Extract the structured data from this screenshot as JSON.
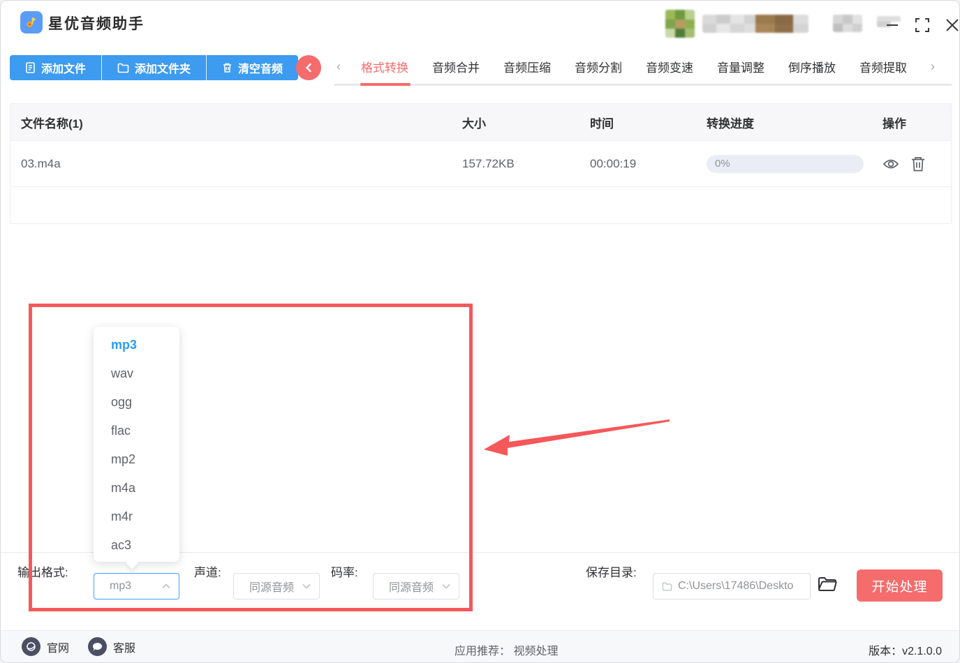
{
  "window": {
    "title": "星优音频助手"
  },
  "toolbar": {
    "add_file": "添加文件",
    "add_folder": "添加文件夹",
    "clear_audio": "清空音频"
  },
  "tabs": [
    "格式转换",
    "音频合并",
    "音频压缩",
    "音频分割",
    "音频变速",
    "音量调整",
    "倒序播放",
    "音频提取"
  ],
  "active_tab": "格式转换",
  "table": {
    "headers": [
      "文件名称(1)",
      "大小",
      "时间",
      "转换进度",
      "操作"
    ],
    "rows": [
      {
        "name": "03.m4a",
        "size": "157.72KB",
        "duration": "00:00:19",
        "progress": "0%"
      }
    ]
  },
  "dropdown": {
    "selected": "mp3",
    "options": [
      "mp3",
      "wav",
      "ogg",
      "flac",
      "mp2",
      "m4a",
      "m4r",
      "ac3"
    ]
  },
  "controls": {
    "output_format_label": "输出格式:",
    "output_format_value": "mp3",
    "channel_label": "声道:",
    "channel_value": "同源音频",
    "bitrate_label": "码率:",
    "bitrate_value": "同源音频",
    "save_dir_label": "保存目录:",
    "save_dir_value": "C:\\Users\\17486\\Deskto",
    "start_button": "开始处理"
  },
  "footer": {
    "official_site": "官网",
    "support": "客服",
    "recommend_label": "应用推荐：",
    "recommend_value": "视频处理",
    "version": "版本：v2.1.0.0"
  },
  "colors": {
    "accent_blue": "#3d9bf0",
    "accent_red": "#f56c6c",
    "annotation_red": "#f5585a",
    "selected_option_blue": "#2b9df4",
    "progress_track": "#eaedf5"
  }
}
